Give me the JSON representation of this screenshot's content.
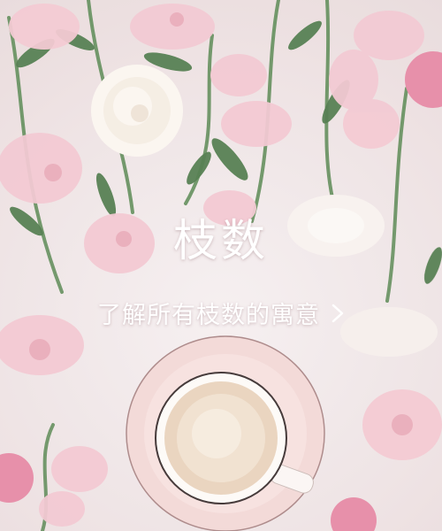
{
  "banner": {
    "title": "枝数",
    "link_label": "了解所有枝数的寓意",
    "link_icon": "chevron-right-icon"
  },
  "colors": {
    "text": "#ffffff",
    "background": "#efe4e4",
    "petal_pink": "#f2c7d0",
    "deep_pink": "#e68aa5",
    "leaf_green": "#4f7a4a"
  }
}
